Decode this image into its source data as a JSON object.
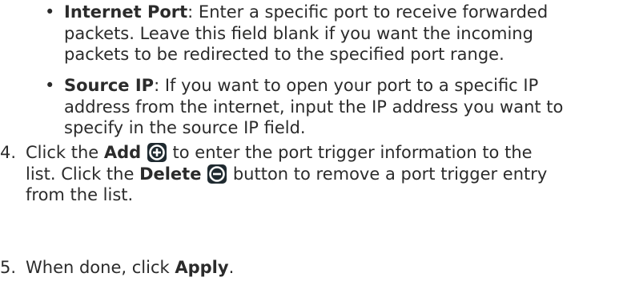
{
  "bullets": [
    {
      "term": "Internet Port",
      "line1": ": Enter a specific port to receive forwarded",
      "line2": "packets. Leave this field blank if you want the incoming",
      "line3": "packets to be redirected to the specified port range."
    },
    {
      "term": "Source IP",
      "line1": ": If you want to open your port to a specific IP",
      "line2": "address from the internet, input the IP address you want to",
      "line3": "specify in the source IP field."
    }
  ],
  "bullet_symbol": "•",
  "steps": [
    {
      "number": "4.",
      "pre": "Click the ",
      "add_label": "Add",
      "mid": " to enter the port trigger information to the",
      "line2_pre": "list. Click the ",
      "delete_label": "Delete",
      "line2_post": " button to remove a port trigger entry",
      "line3": "from the list."
    },
    {
      "number": "5.",
      "pre": "When done, click ",
      "apply_label": "Apply",
      "post": "."
    }
  ],
  "icons": {
    "add": "add-circle-icon",
    "delete": "delete-circle-icon",
    "icon_bg": "#1f2a30",
    "icon_fg": "#ffffff"
  }
}
